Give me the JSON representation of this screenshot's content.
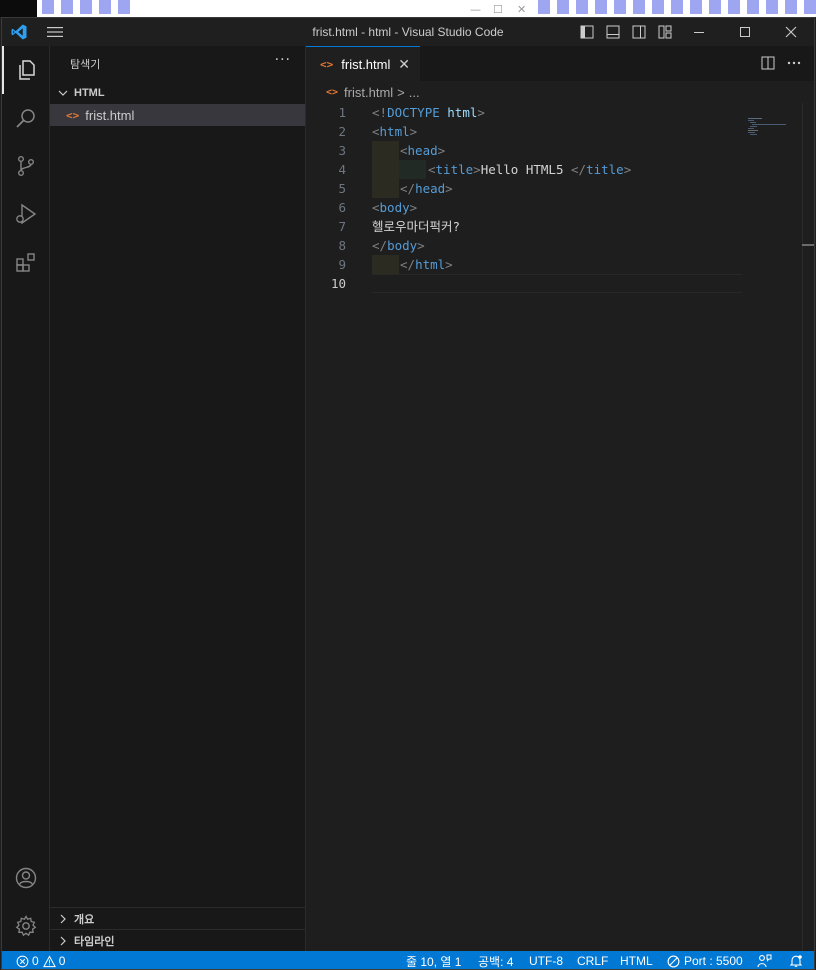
{
  "window": {
    "title": "frist.html - html - Visual Studio Code"
  },
  "explorer": {
    "title": "탐색기",
    "more": "···",
    "folder": "HTML",
    "file": {
      "icon": "html-file-icon",
      "name": "frist.html"
    },
    "sections": [
      {
        "label": "개요"
      },
      {
        "label": "타임라인"
      }
    ]
  },
  "tabs": [
    {
      "label": "frist.html",
      "active": true
    }
  ],
  "breadcrumb": {
    "file": "frist.html",
    "sep": ">",
    "more": "..."
  },
  "editor": {
    "current_line": 10,
    "line_numbers": [
      "1",
      "2",
      "3",
      "4",
      "5",
      "6",
      "7",
      "8",
      "9",
      "10"
    ],
    "lines": [
      {
        "open": "<!",
        "kw": "DOCTYPE",
        "sp": " ",
        "attr": "html",
        "close": ">"
      },
      {
        "open": "<",
        "tag": "html",
        "close": ">"
      },
      {
        "open": "<",
        "tag": "head",
        "close": ">"
      },
      {
        "open": "<",
        "tag": "title",
        "close": ">",
        "text": "Hello HTML5 ",
        "open2": "</",
        "tag2": "title",
        "close2": ">"
      },
      {
        "open": "</",
        "tag": "head",
        "close": ">"
      },
      {
        "open": "<",
        "tag": "body",
        "close": ">"
      },
      {
        "text": "헬로우마더퍽커?"
      },
      {
        "open": "</",
        "tag": "body",
        "close": ">"
      },
      {
        "open": "</",
        "tag": "html",
        "close": ">"
      },
      {
        "text": ""
      }
    ]
  },
  "statusbar": {
    "errors": "0",
    "warnings": "0",
    "position": "줄 10, 열 1",
    "spaces": "공백: 4",
    "encoding": "UTF-8",
    "eol": "CRLF",
    "language": "HTML",
    "port": "Port : 5500"
  },
  "colors": {
    "accent": "#0078d4",
    "statusbar": "#0078d4",
    "file_icon": "#e37933",
    "tag": "#569cd6"
  }
}
